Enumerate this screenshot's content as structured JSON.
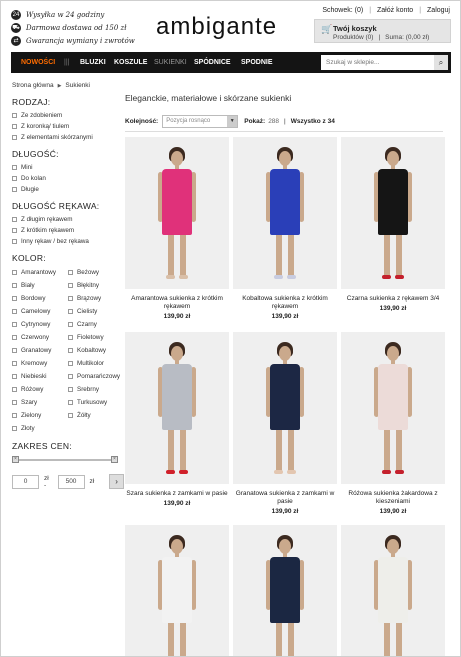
{
  "header": {
    "promos": [
      {
        "icon": "clock-icon",
        "glyph": "24",
        "text": "Wysyłka w 24 godziny"
      },
      {
        "icon": "truck-icon",
        "glyph": "⛟",
        "text": "Darmowa dostawa od 150 zł"
      },
      {
        "icon": "return-icon",
        "glyph": "⇄",
        "text": "Gwarancja wymiany i zwrotów"
      }
    ],
    "logo": "ambigante",
    "toplinks": {
      "schowek": "Schowek: (0)",
      "register": "Załóż konto",
      "login": "Zaloguj",
      "sep": "|"
    },
    "cart": {
      "title": "Twój koszyk",
      "products": "Produktów (0)",
      "sep": "|",
      "sum": "Suma: (0,00 zł)"
    }
  },
  "nav": {
    "items": [
      "NOWOŚCI",
      "|||",
      "BLUZKI",
      "KOSZULE",
      "SUKIENKI",
      "SPÓDNICE",
      "SPODNIE"
    ],
    "search_placeholder": "Szukaj w sklepie...",
    "colors": {
      "bar": "#141414",
      "new": "#ff6c00",
      "active": "#999999"
    }
  },
  "breadcrumb": {
    "home": "Strona główna",
    "current": "Sukienki"
  },
  "sidebar": {
    "rodzaj": {
      "title": "RODZAJ:",
      "options": [
        "Ze zdobieniem",
        "Z koronką/ tiulem",
        "Z elementami skórzanymi"
      ]
    },
    "dlugosc": {
      "title": "DŁUGOŚĆ:",
      "options": [
        "Mini",
        "Do kolan",
        "Długie"
      ]
    },
    "rekaw": {
      "title": "DŁUGOŚĆ RĘKAWA:",
      "options": [
        "Z długim rękawem",
        "Z krótkim rękawem",
        "Inny rękaw / bez rękawa"
      ]
    },
    "kolor": {
      "title": "KOLOR:",
      "options": [
        "Amarantowy",
        "Beżowy",
        "Biały",
        "Błękitny",
        "Bordowy",
        "Brązowy",
        "Camelowy",
        "Cielisty",
        "Cytrynowy",
        "Czarny",
        "Czerwony",
        "Fioletowy",
        "Granatowy",
        "Kobaltowy",
        "Kremowy",
        "Multikolor",
        "Niebieski",
        "Pomarańczowy",
        "Różowy",
        "Srebrny",
        "Szary",
        "Turkusowy",
        "Zielony",
        "Żółty",
        "Złoty"
      ]
    },
    "cena": {
      "title": "ZAKRES CEN:",
      "min": "0",
      "max": "500",
      "currency": "zł",
      "dash": "zł -",
      "go": "›"
    }
  },
  "main": {
    "heading": "Eleganckie, materiałowe i skórzane sukienki",
    "sort_label": "Kolejność:",
    "sort_value": "Pozycja rosnąco",
    "show_label": "Pokaż:",
    "show_count": "288",
    "bar_sep": "|",
    "show_all": "Wszystko z 34",
    "products": [
      {
        "name": "Amarantowa sukienka z krótkim rękawem",
        "price": "139,90 zł",
        "color": "#e0317a",
        "shoe": "#d9bfa8"
      },
      {
        "name": "Kobaltowa sukienka z krótkim rękawem",
        "price": "139,90 zł",
        "color": "#2a3fb8",
        "shoe": "#c8cce0"
      },
      {
        "name": "Czarna sukienka z rękawem 3/4",
        "price": "139,90 zł",
        "color": "#151515",
        "shoe": "#c4202c"
      },
      {
        "name": "Szara sukienka z zamkami w pasie",
        "price": "139,90 zł",
        "color": "#b8bcc4",
        "shoe": "#d0202a"
      },
      {
        "name": "Granatowa sukienka z zamkami w pasie",
        "price": "139,90 zł",
        "color": "#1c2744",
        "shoe": "#e3c6b0"
      },
      {
        "name": "Różowa sukienka żakardowa z kieszeniami",
        "price": "139,90 zł",
        "color": "#ecdbd8",
        "shoe": "#c4202c"
      },
      {
        "name": "",
        "price": "",
        "color": "#f2f2f2",
        "shoe": "#111111"
      },
      {
        "name": "",
        "price": "",
        "color": "#1b2742",
        "shoe": "#e3c6b0"
      },
      {
        "name": "",
        "price": "",
        "color": "#eeeeea",
        "shoe": "#d7d7d7"
      }
    ]
  }
}
